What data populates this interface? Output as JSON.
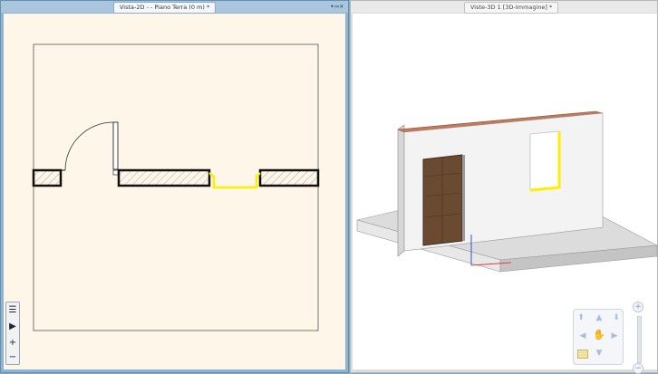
{
  "left_view": {
    "title": "Vista-2D -  - Piano Terra (0 m) *",
    "window_controls": "▾▭✕",
    "tools": [
      {
        "icon": "list-icon",
        "glyph": "☰"
      },
      {
        "icon": "expand-arrow-icon",
        "glyph": "▶"
      },
      {
        "icon": "zoom-in-icon",
        "glyph": "+"
      },
      {
        "icon": "zoom-out-icon",
        "glyph": "−"
      }
    ],
    "colors": {
      "background": "#fdf6e9",
      "wall_fill": "#ffffff",
      "window_highlight": "#ffee00"
    }
  },
  "right_view": {
    "title": "Viste-3D 1 [3D-Immagine] *",
    "nav": {
      "up": "▲",
      "down": "▼",
      "left": "◀",
      "right": "▶",
      "rotate_up_left": "⬆",
      "rotate_up_right": "⬇",
      "pan_hand": "✋"
    },
    "zoom": {
      "plus": "+",
      "minus": "−"
    },
    "colors": {
      "wall": "#f2f2f2",
      "floor": "#dcdcdc",
      "wall_top": "#c27a5a",
      "door": "#6b4a32",
      "window_frame": "#ffee00"
    }
  }
}
